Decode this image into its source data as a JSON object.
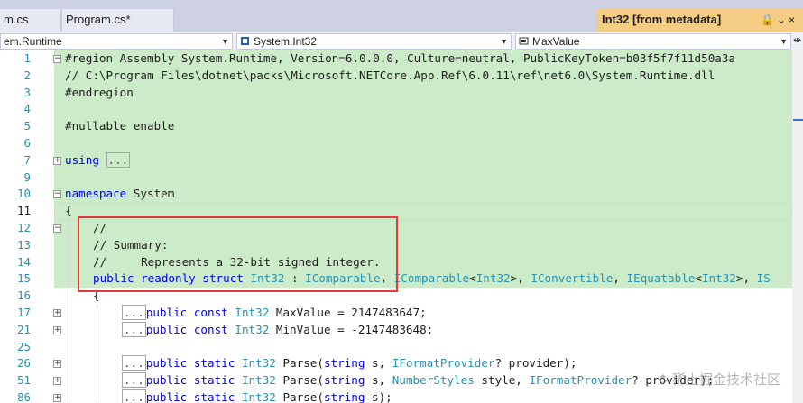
{
  "tabs": [
    {
      "label": "m.cs"
    },
    {
      "label": "Program.cs*"
    },
    {
      "label": "Int32 [from metadata]",
      "icons": "🔒 ⌄ ×"
    }
  ],
  "navbar": {
    "project": "em.Runtime",
    "type": "System.Int32",
    "member": "MaxValue"
  },
  "editor": {
    "lines": [
      {
        "n": "1",
        "text": "#region Assembly System.Runtime, Version=6.0.0.0, Culture=neutral, PublicKeyToken=b03f5f7f11d50a3a"
      },
      {
        "n": "2",
        "text": "// C:\\Program Files\\dotnet\\packs\\Microsoft.NETCore.App.Ref\\6.0.11\\ref\\net6.0\\System.Runtime.dll"
      },
      {
        "n": "3",
        "text": "#endregion"
      },
      {
        "n": "4",
        "text": ""
      },
      {
        "n": "5",
        "text": "#nullable enable"
      },
      {
        "n": "6",
        "text": ""
      },
      {
        "n": "7",
        "text": "using ..."
      },
      {
        "n": "9",
        "text": ""
      },
      {
        "n": "10",
        "text": "namespace System"
      },
      {
        "n": "11",
        "text": "{"
      },
      {
        "n": "12",
        "text": "//"
      },
      {
        "n": "13",
        "text": "// Summary:"
      },
      {
        "n": "14",
        "text": "//     Represents a 32-bit signed integer."
      },
      {
        "n": "15",
        "text": "public readonly struct Int32 : IComparable, IComparable<Int32>, IConvertible, IEquatable<Int32>, IS"
      },
      {
        "n": "16",
        "text": "{"
      },
      {
        "n": "17",
        "text": "public const Int32 MaxValue = 2147483647;"
      },
      {
        "n": "21",
        "text": "public const Int32 MinValue = -2147483648;"
      },
      {
        "n": "25",
        "text": ""
      },
      {
        "n": "26",
        "text": "public static Int32 Parse(string s, IFormatProvider? provider);"
      },
      {
        "n": "51",
        "text": "public static Int32 Parse(string s, NumberStyles style, IFormatProvider? provider);"
      },
      {
        "n": "86",
        "text": "public static Int32 Parse(string s);"
      }
    ],
    "collapsed_marker": "...",
    "current_line": "11"
  },
  "watermark": "稀土掘金技术社区",
  "colors": {
    "tabbar": "#cdd1e1",
    "active_tab": "#f5cc84",
    "line_highlight": "#ccebc8",
    "keyword": "#0000ff",
    "type": "#2b91af",
    "comment": "#008000",
    "preprocessor": "#808080",
    "highlight_box": "#e33b3b"
  },
  "icons": [
    "lock-icon",
    "chevron-down-icon",
    "close-icon",
    "namespace-icon",
    "struct-icon",
    "field-icon",
    "split-icon"
  ]
}
